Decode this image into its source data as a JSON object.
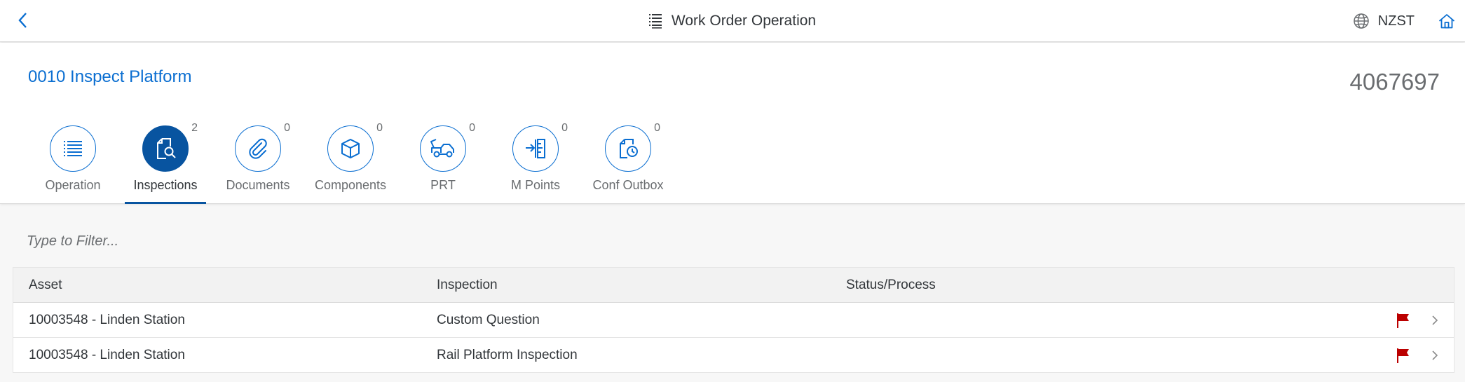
{
  "shell": {
    "title": "Work Order Operation",
    "timezone": "NZST",
    "icons": {
      "back": "navigation-left-arrow-icon",
      "title": "list-icon",
      "globe": "globe-icon",
      "home": "home-icon"
    }
  },
  "header": {
    "object_title": "0010 Inspect Platform",
    "object_number": "4067697"
  },
  "tabs": [
    {
      "label": "Operation",
      "count": "",
      "icon": "list-icon",
      "active": false
    },
    {
      "label": "Inspections",
      "count": "2",
      "icon": "inspection-search-icon",
      "active": true
    },
    {
      "label": "Documents",
      "count": "0",
      "icon": "paperclip-icon",
      "active": false
    },
    {
      "label": "Components",
      "count": "0",
      "icon": "cube-icon",
      "active": false
    },
    {
      "label": "PRT",
      "count": "0",
      "icon": "tow-truck-icon",
      "active": false
    },
    {
      "label": "M Points",
      "count": "0",
      "icon": "measuring-point-icon",
      "active": false
    },
    {
      "label": "Conf Outbox",
      "count": "0",
      "icon": "document-clock-icon",
      "active": false
    }
  ],
  "filter": {
    "placeholder": "Type to Filter..."
  },
  "table": {
    "columns": [
      "Asset",
      "Inspection",
      "Status/Process"
    ],
    "rows": [
      {
        "asset": "10003548 - Linden Station",
        "inspection": "Custom Question",
        "status": "",
        "flag": "flag-icon"
      },
      {
        "asset": "10003548 - Linden Station",
        "inspection": "Rail Platform Inspection",
        "status": "",
        "flag": "flag-icon"
      }
    ]
  },
  "colors": {
    "accent": "#0a6ed1",
    "active_tab": "#0854a0",
    "flag": "#bb0000"
  }
}
